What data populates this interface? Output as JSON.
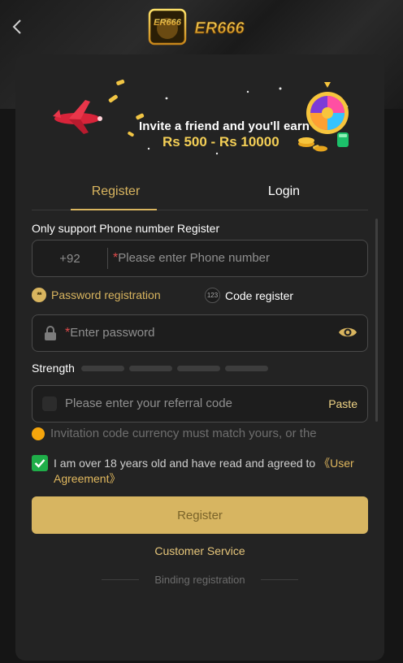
{
  "header": {
    "back_icon": "chevron-left-icon",
    "logo_text": "ER666"
  },
  "banner": {
    "line1": "Invite a friend and you'll earn",
    "line2": "Rs 500 - Rs 10000"
  },
  "tabs": {
    "register": "Register",
    "login": "Login",
    "active": "register"
  },
  "form": {
    "support_hint": "Only support Phone number Register",
    "country_code": "+92",
    "required_mark": "*",
    "phone_placeholder": "Please enter Phone number",
    "password_registration": "Password registration",
    "code_register": "Code register",
    "code_icon_text": "123",
    "password_placeholder": "Enter password",
    "strength_label": "Strength",
    "referral_placeholder": "Please enter your referral code",
    "paste_label": "Paste",
    "invitation_notice": "Invitation code currency must match yours, or the",
    "agree_text": "I am over 18 years old and have read and agreed to ",
    "user_agreement": "《User Agreement》",
    "agree_checked": true,
    "register_button": "Register",
    "customer_service": "Customer Service",
    "binding_registration": "Binding registration"
  },
  "colors": {
    "accent_gold": "#d9b55f",
    "button_gold": "#d7b561",
    "check_green": "#1fae49",
    "notice_orange": "#f5a50c",
    "required_red": "#e14b4b"
  }
}
